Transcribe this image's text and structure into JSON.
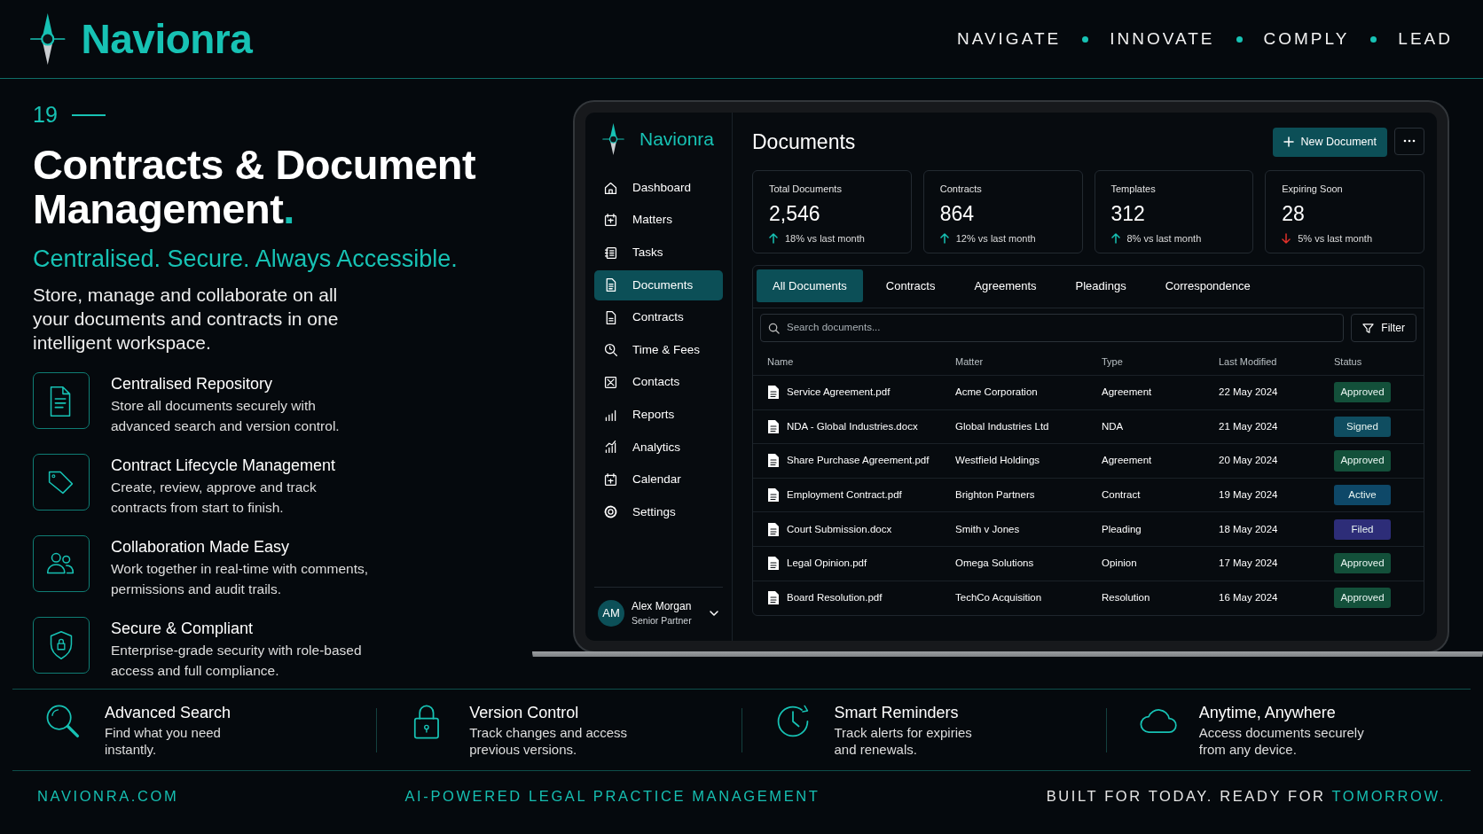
{
  "brand": {
    "name": "Navionra"
  },
  "tagline": [
    "NAVIGATE",
    "INNOVATE",
    "COMPLY",
    "LEAD"
  ],
  "intro": {
    "number": "19",
    "title": "Contracts & Document Management",
    "title_accent": ".",
    "subtitle": "Centralised. Secure. Always Accessible.",
    "description": "Store, manage and collaborate on all\nyour documents and contracts in one\nintelligent workspace."
  },
  "features": [
    {
      "title": "Centralised Repository",
      "text": "Store all documents securely with\nadvanced search and version control."
    },
    {
      "title": "Contract Lifecycle Management",
      "text": "Create, review, approve and track\ncontracts from start to finish."
    },
    {
      "title": "Collaboration Made Easy",
      "text": "Work together in real-time with comments,\npermissions and audit trails."
    },
    {
      "title": "Secure & Compliant",
      "text": "Enterprise-grade security with role-based\naccess and full compliance."
    }
  ],
  "app": {
    "brand": "Navionra",
    "nav": [
      {
        "label": "Dashboard",
        "selected": false
      },
      {
        "label": "Matters",
        "selected": false
      },
      {
        "label": "Tasks",
        "selected": false
      },
      {
        "label": "Documents",
        "selected": true
      },
      {
        "label": "Contracts",
        "selected": false
      },
      {
        "label": "Time & Fees",
        "selected": false
      },
      {
        "label": "Contacts",
        "selected": false
      },
      {
        "label": "Reports",
        "selected": false
      },
      {
        "label": "Analytics",
        "selected": false
      },
      {
        "label": "Calendar",
        "selected": false
      },
      {
        "label": "Settings",
        "selected": false
      }
    ],
    "user": {
      "initials": "AM",
      "name": "Alex Morgan",
      "role": "Senior Partner"
    },
    "page_title": "Documents",
    "new_button": "New Document",
    "stats": [
      {
        "label": "Total Documents",
        "value": "2,546",
        "change": "18% vs last month",
        "increase": true
      },
      {
        "label": "Contracts",
        "value": "864",
        "change": "12% vs last month",
        "increase": true
      },
      {
        "label": "Templates",
        "value": "312",
        "change": "8% vs last month",
        "increase": true
      },
      {
        "label": "Expiring Soon",
        "value": "28",
        "change": "5% vs last month",
        "increase": false
      }
    ],
    "tabs": [
      {
        "label": "All Documents",
        "selected": true
      },
      {
        "label": "Contracts",
        "selected": false
      },
      {
        "label": "Agreements",
        "selected": false
      },
      {
        "label": "Pleadings",
        "selected": false
      },
      {
        "label": "Correspondence",
        "selected": false
      }
    ],
    "search": {
      "placeholder": "Search documents..."
    },
    "filter_button": "Filter",
    "table": {
      "columns": [
        "Name",
        "Matter",
        "Type",
        "Last Modified",
        "Status"
      ],
      "rows": [
        {
          "name": "Service Agreement.pdf",
          "matter": "Acme Corporation",
          "type": "Agreement",
          "modified": "22 May 2024",
          "status": "Approved",
          "color": "#13503a"
        },
        {
          "name": "NDA - Global Industries.docx",
          "matter": "Global Industries Ltd",
          "type": "NDA",
          "modified": "21 May 2024",
          "status": "Signed",
          "color": "#0f4d60"
        },
        {
          "name": "Share Purchase Agreement.pdf",
          "matter": "Westfield Holdings",
          "type": "Agreement",
          "modified": "20 May 2024",
          "status": "Approved",
          "color": "#13503a"
        },
        {
          "name": "Employment Contract.pdf",
          "matter": "Brighton Partners",
          "type": "Contract",
          "modified": "19 May 2024",
          "status": "Active",
          "color": "#0e4868"
        },
        {
          "name": "Court Submission.docx",
          "matter": "Smith v Jones",
          "type": "Pleading",
          "modified": "18 May 2024",
          "status": "Filed",
          "color": "#2d2d78"
        },
        {
          "name": "Legal Opinion.pdf",
          "matter": "Omega Solutions",
          "type": "Opinion",
          "modified": "17 May 2024",
          "status": "Approved",
          "color": "#13503a"
        },
        {
          "name": "Board Resolution.pdf",
          "matter": "TechCo Acquisition",
          "type": "Resolution",
          "modified": "16 May 2024",
          "status": "Approved",
          "color": "#13503a"
        }
      ]
    }
  },
  "highlights": [
    {
      "title": "Advanced Search",
      "text": "Find what you need\ninstantly."
    },
    {
      "title": "Version Control",
      "text": "Track changes and access\nprevious versions."
    },
    {
      "title": "Smart Reminders",
      "text": "Track alerts for expiries\nand renewals."
    },
    {
      "title": "Anytime, Anywhere",
      "text": "Access documents securely\nfrom any device."
    }
  ],
  "footer": {
    "website": "NAVIONRA.COM",
    "center": "AI-POWERED LEGAL PRACTICE MANAGEMENT",
    "right": "BUILT FOR TODAY. READY FOR",
    "right_accent": "TOMORROW."
  }
}
